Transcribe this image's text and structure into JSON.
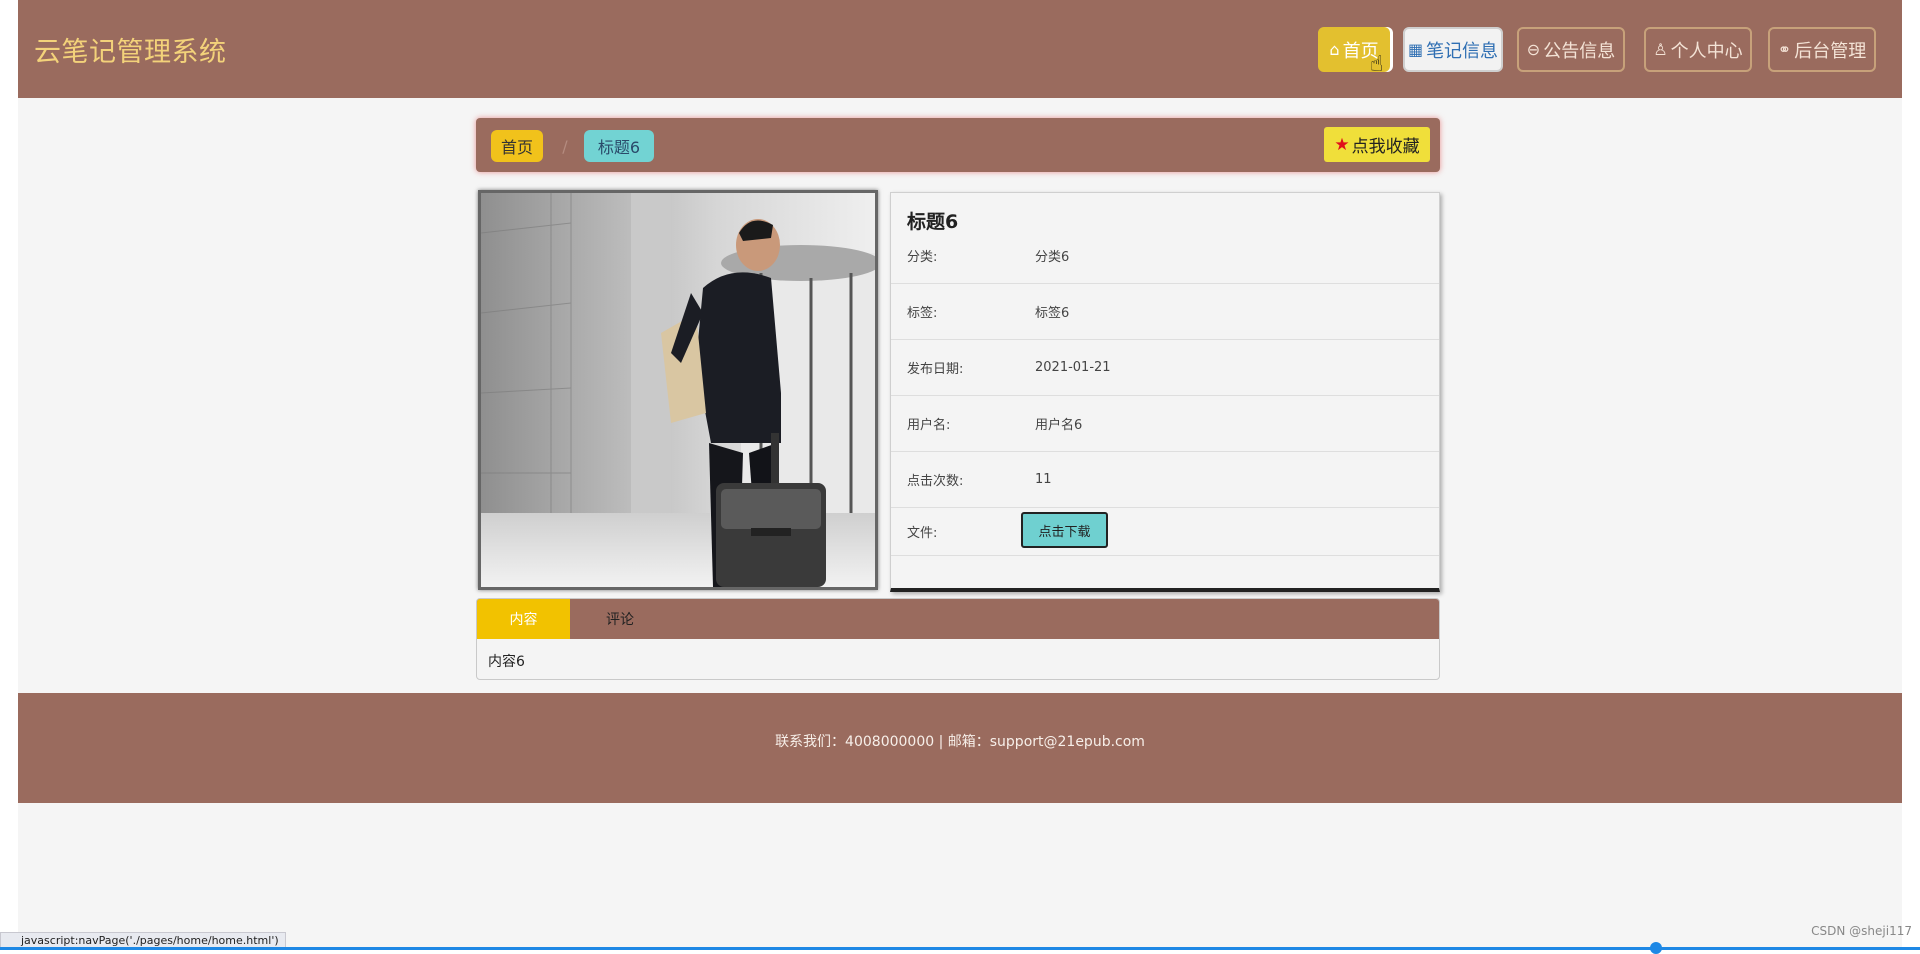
{
  "header": {
    "brand": "云笔记管理系统",
    "nav": [
      {
        "label": "首页",
        "icon": "home-icon"
      },
      {
        "label": "笔记信息",
        "icon": "grid-icon"
      },
      {
        "label": "公告信息",
        "icon": "notice-icon"
      },
      {
        "label": "个人中心",
        "icon": "user-icon"
      },
      {
        "label": "后台管理",
        "icon": "link-icon"
      }
    ]
  },
  "breadcrumb": {
    "home": "首页",
    "separator": "/",
    "current": "标题6",
    "favorite": "点我收藏"
  },
  "detail": {
    "title": "标题6",
    "rows": [
      {
        "label": "分类:",
        "value": "分类6"
      },
      {
        "label": "标签:",
        "value": "标签6"
      },
      {
        "label": "发布日期:",
        "value": "2021-01-21"
      },
      {
        "label": "用户名:",
        "value": "用户名6"
      },
      {
        "label": "点击次数:",
        "value": "11"
      }
    ],
    "file_label": "文件:",
    "download": "点击下载"
  },
  "tabs": {
    "items": [
      "内容",
      "评论"
    ],
    "active": "内容",
    "content": "内容6"
  },
  "footer": {
    "text": "联系我们：4008000000 | 邮箱：support@21epub.com"
  },
  "status": {
    "url": "javascript:navPage('./pages/home/home.html')",
    "watermark": "CSDN @sheji117"
  },
  "colors": {
    "primary": "#9a6b5e",
    "accent_yellow": "#f2c200",
    "accent_cyan": "#72d3d3",
    "brand_text": "#f3d27a"
  }
}
